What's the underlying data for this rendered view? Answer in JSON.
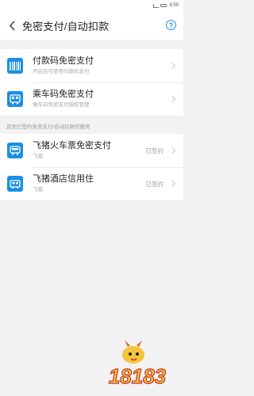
{
  "status_bar": {
    "time": "9:59"
  },
  "nav": {
    "title": "免密支付/自动扣款",
    "help_symbol": "?"
  },
  "group1": [
    {
      "title": "付款码免密支付",
      "subtitle": "开启后可使用付款码支付",
      "icon": "barcode-icon"
    },
    {
      "title": "乘车码免密支付",
      "subtitle": "乘车码免密支付授权管理",
      "icon": "bus-card-icon"
    }
  ],
  "section_label": "其他已签约免密支付/自动扣款的服务",
  "group2": [
    {
      "title": "飞猪火车票免密支付",
      "subtitle": "飞猪",
      "status": "已签约",
      "icon": "train-icon"
    },
    {
      "title": "飞猪酒店信用住",
      "subtitle": "飞猪",
      "status": "已签约",
      "icon": "hotel-icon"
    }
  ],
  "watermark": {
    "text": "18183"
  },
  "colors": {
    "accent": "#1a8fe3",
    "background": "#f2f2f2"
  }
}
